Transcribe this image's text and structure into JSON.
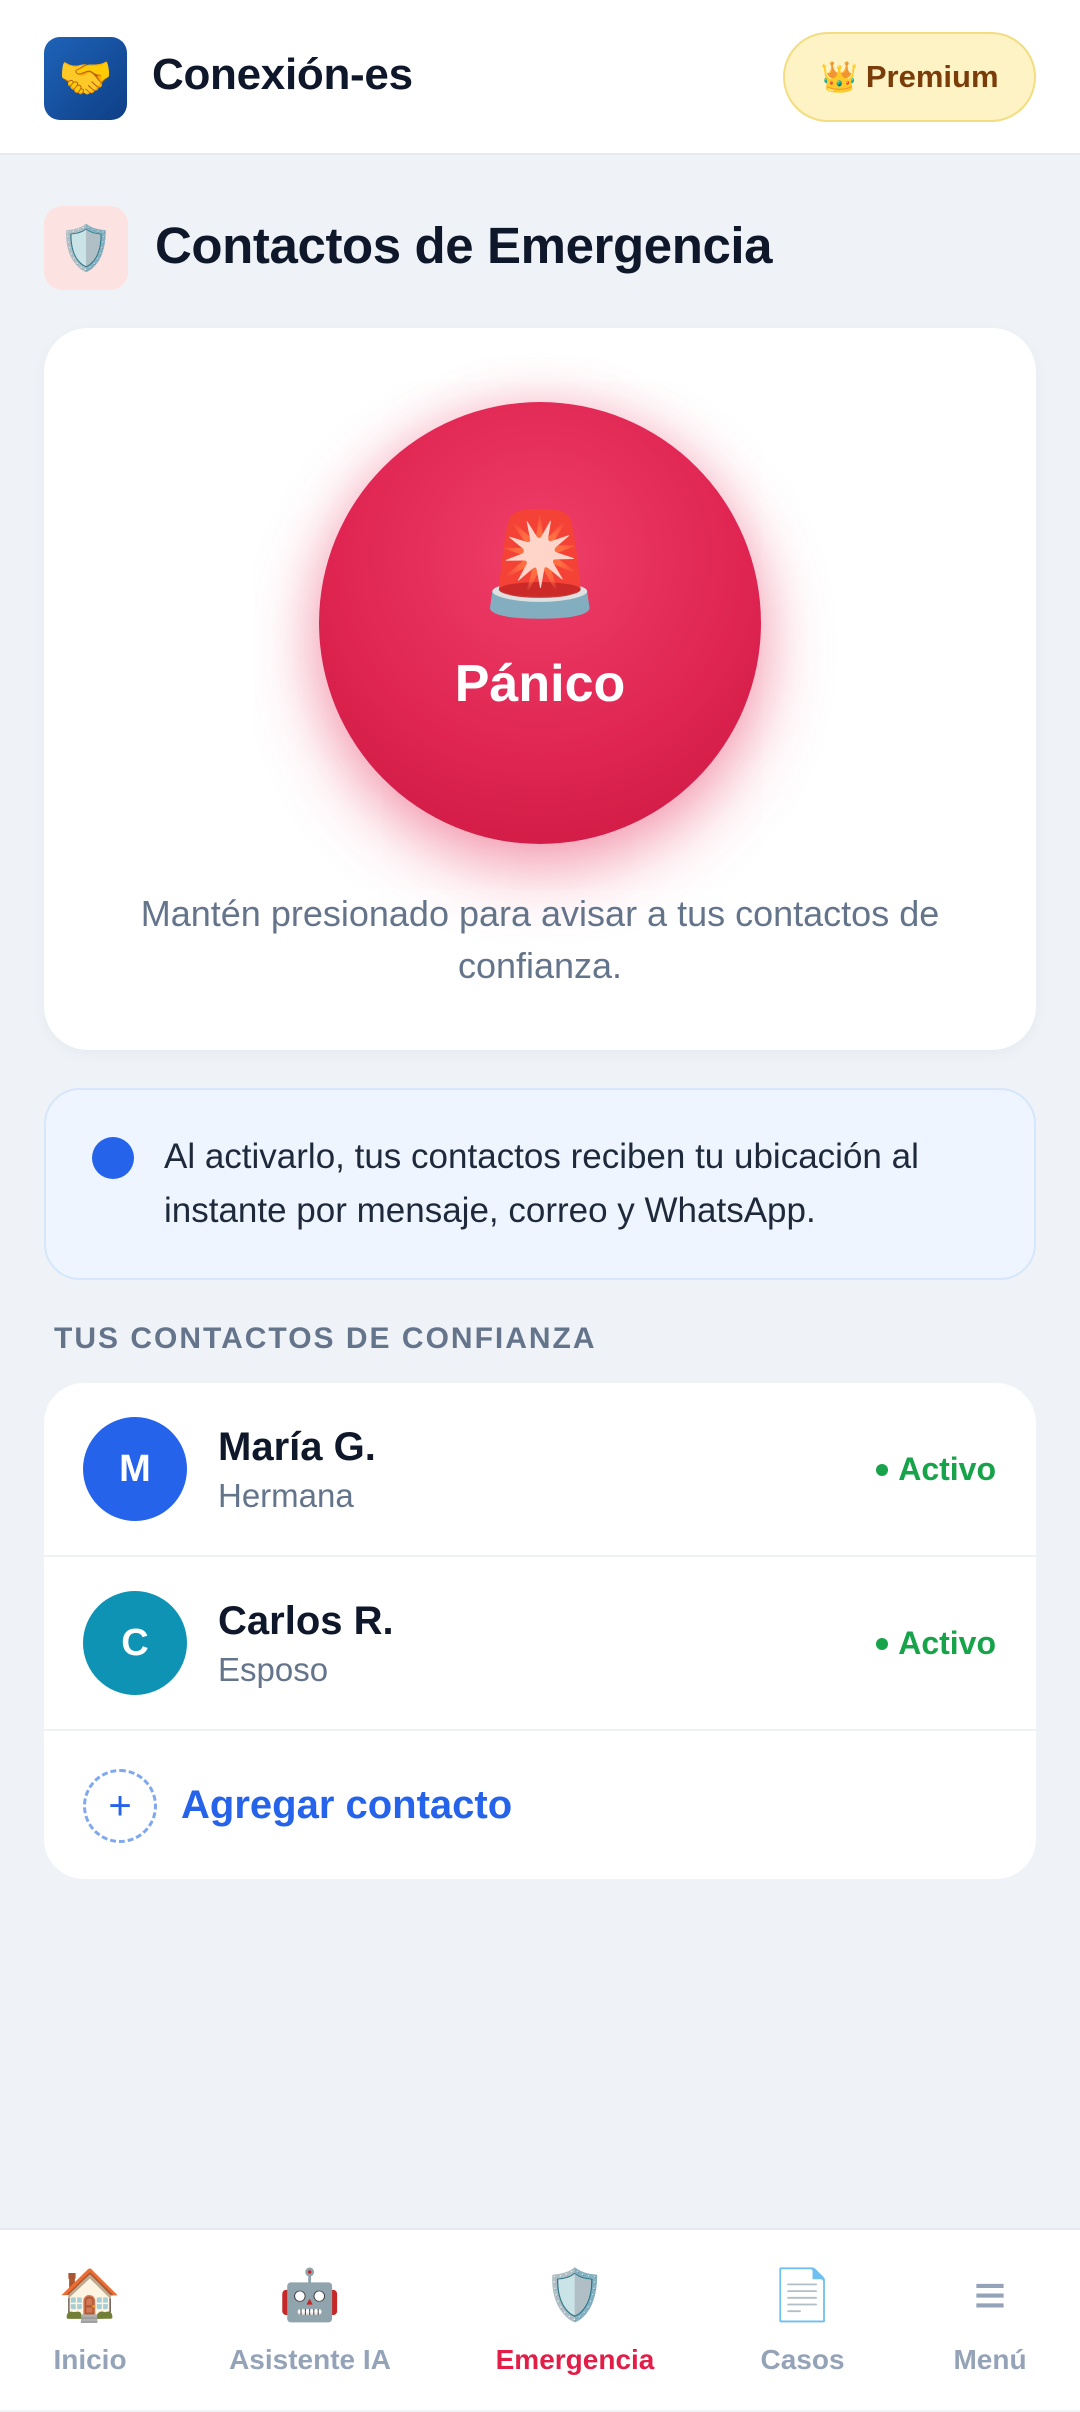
{
  "header": {
    "logo_icon": "🤝",
    "app_name": "Conexión-es",
    "premium": {
      "icon": "👑",
      "label": "Premium"
    }
  },
  "section": {
    "icon": "🛡️",
    "title": "Contactos de Emergencia"
  },
  "panic": {
    "icon": "🚨",
    "label": "Pánico",
    "hint": "Mantén presionado para avisar a tus contactos de confianza."
  },
  "info": {
    "text": "Al activarlo, tus contactos reciben tu ubicación al instante por mensaje, correo y WhatsApp."
  },
  "contacts": {
    "heading": "TUS CONTACTOS DE CONFIANZA",
    "items": [
      {
        "initial": "M",
        "name": "María G.",
        "relation": "Hermana",
        "status": "Activo",
        "avatar_color": "#2563eb"
      },
      {
        "initial": "C",
        "name": "Carlos R.",
        "relation": "Esposo",
        "status": "Activo",
        "avatar_color": "#0e93b4"
      }
    ],
    "add_icon": "+",
    "add_label": "Agregar contacto"
  },
  "nav": {
    "items": [
      {
        "icon": "🏠",
        "label": "Inicio",
        "active": false
      },
      {
        "icon": "🤖",
        "label": "Asistente IA",
        "active": false
      },
      {
        "icon": "🛡️",
        "label": "Emergencia",
        "active": true
      },
      {
        "icon": "📄",
        "label": "Casos",
        "active": false
      },
      {
        "icon": "≡",
        "label": "Menú",
        "active": false
      }
    ]
  },
  "colors": {
    "accent_red": "#e11d48",
    "panic_red": "#e02552",
    "primary_blue": "#2563eb",
    "status_green": "#16a34a",
    "background": "#eff3f8"
  }
}
